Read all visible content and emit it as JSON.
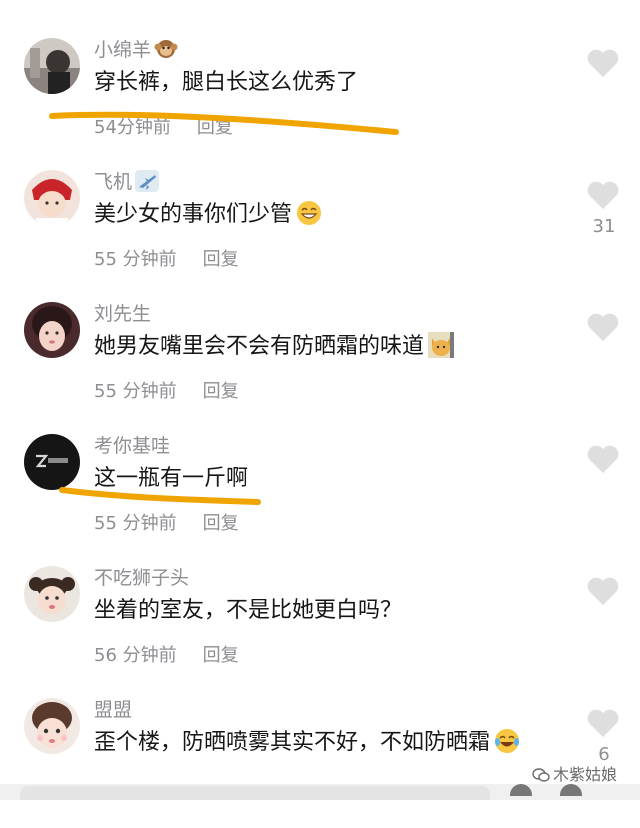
{
  "comments": [
    {
      "name": "小绵羊",
      "name_emoji": "monkey-emoji",
      "text": "穿长裤，腿白长这么优秀了",
      "text_emoji": "",
      "time": "54分钟前",
      "reply": "回复",
      "likes": ""
    },
    {
      "name": "飞机",
      "name_emoji": "airplane-emoji",
      "text": "美少女的事你们少管",
      "text_emoji": "grin-emoji",
      "time": "55 分钟前",
      "reply": "回复",
      "likes": "31"
    },
    {
      "name": "刘先生",
      "name_emoji": "",
      "text": "她男友嘴里会不会有防晒霜的味道",
      "text_emoji": "cat-emoji",
      "time": "55 分钟前",
      "reply": "回复",
      "likes": ""
    },
    {
      "name": "考你基哇",
      "name_emoji": "",
      "text": "这一瓶有一斤啊",
      "text_emoji": "",
      "time": "55 分钟前",
      "reply": "回复",
      "likes": ""
    },
    {
      "name": "不吃狮子头",
      "name_emoji": "",
      "text": "坐着的室友，不是比她更白吗？",
      "text_emoji": "",
      "time": "56 分钟前",
      "reply": "回复",
      "likes": ""
    },
    {
      "name": "盟盟",
      "name_emoji": "",
      "text": "歪个楼，防晒喷雾其实不好，不如防晒霜",
      "text_emoji": "laugh-cry-emoji",
      "time": "",
      "reply": "",
      "likes": "6"
    }
  ],
  "watermark": "木紫姑娘",
  "colors": {
    "annotation": "#f0a400",
    "heart": "#dedede",
    "meta": "#8e8e93"
  }
}
